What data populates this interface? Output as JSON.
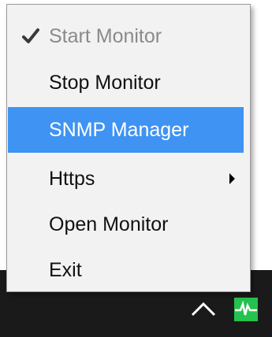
{
  "menu": {
    "items": [
      {
        "label": "Start Monitor",
        "checked": true,
        "disabled": true
      },
      {
        "label": "Stop Monitor"
      },
      {
        "label": "SNMP Manager",
        "highlighted": true
      },
      {
        "label": "Https",
        "submenu": true
      },
      {
        "label": "Open Monitor"
      },
      {
        "label": "Exit"
      }
    ]
  },
  "tray": {
    "icons": [
      "chevron-up-icon",
      "monitor-app-icon"
    ]
  },
  "colors": {
    "highlight": "#3f93f2",
    "taskbar": "#1a1a1a",
    "tray_icon": "#24c24e"
  }
}
